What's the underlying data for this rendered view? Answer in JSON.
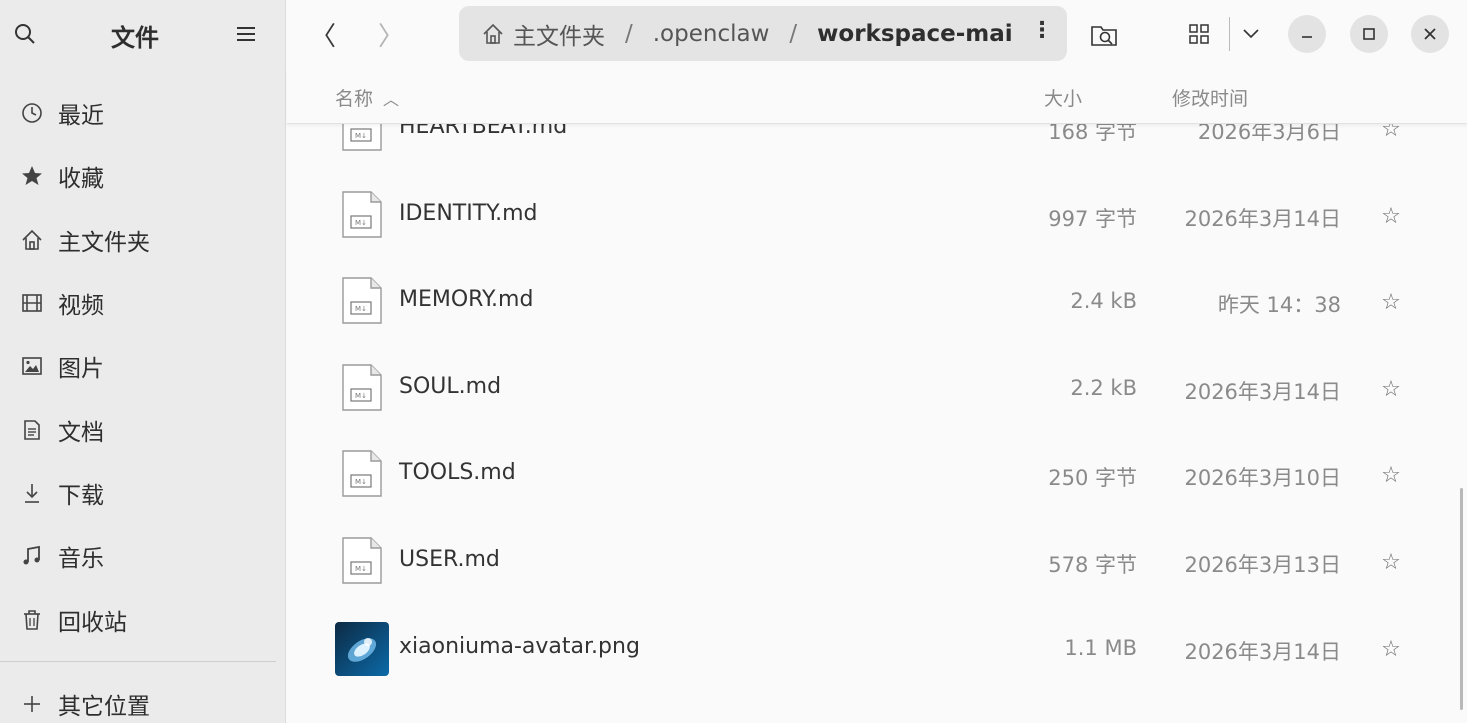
{
  "sidebar": {
    "title": "文件",
    "items": [
      {
        "label": "最近",
        "icon": "clock-icon"
      },
      {
        "label": "收藏",
        "icon": "star-filled-icon"
      },
      {
        "label": "主文件夹",
        "icon": "home-icon"
      },
      {
        "label": "视频",
        "icon": "film-icon"
      },
      {
        "label": "图片",
        "icon": "image-icon"
      },
      {
        "label": "文档",
        "icon": "document-icon"
      },
      {
        "label": "下载",
        "icon": "download-icon"
      },
      {
        "label": "音乐",
        "icon": "music-icon"
      },
      {
        "label": "回收站",
        "icon": "trash-icon"
      }
    ],
    "other_locations": "其它位置"
  },
  "path": {
    "segments": [
      "主文件夹",
      ".openclaw",
      "workspace-mai"
    ],
    "separator": "/",
    "more": "⋮"
  },
  "columns": {
    "name": "名称",
    "size": "大小",
    "date": "修改时间"
  },
  "files": [
    {
      "name": "HEARTBEAT.md",
      "size": "168 字节",
      "date": "2026年3月6日",
      "type": "markdown"
    },
    {
      "name": "IDENTITY.md",
      "size": "997 字节",
      "date": "2026年3月14日",
      "type": "markdown"
    },
    {
      "name": "MEMORY.md",
      "size": "2.4 kB",
      "date": "昨天 14：38",
      "type": "markdown"
    },
    {
      "name": "SOUL.md",
      "size": "2.2 kB",
      "date": "2026年3月14日",
      "type": "markdown"
    },
    {
      "name": "TOOLS.md",
      "size": "250 字节",
      "date": "2026年3月10日",
      "type": "markdown"
    },
    {
      "name": "USER.md",
      "size": "578 字节",
      "date": "2026年3月13日",
      "type": "markdown"
    },
    {
      "name": "xiaoniuma-avatar.png",
      "size": "1.1 MB",
      "date": "2026年3月14日",
      "type": "image"
    }
  ],
  "colors": {
    "sidebar_bg": "#ebebeb",
    "path_bg": "#e4e4e4",
    "text": "#333333",
    "muted": "#8a8a8a"
  }
}
